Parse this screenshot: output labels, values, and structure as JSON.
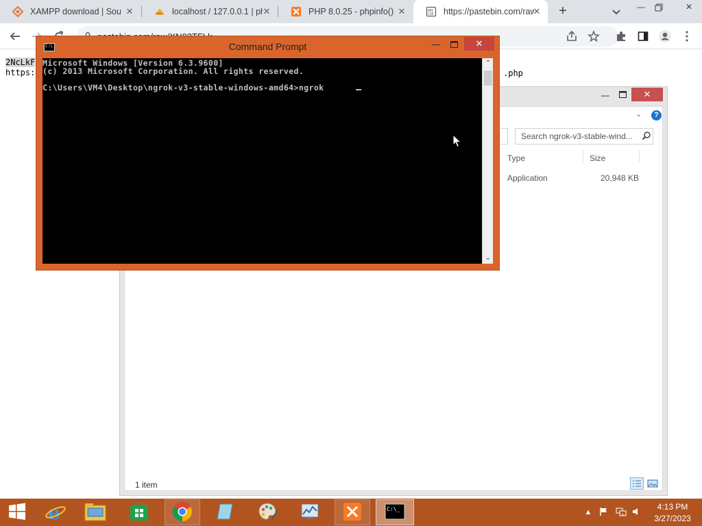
{
  "browser": {
    "tabs": [
      {
        "title": "XAMPP download | Sour",
        "icon": "xampp-orange-icon"
      },
      {
        "title": "localhost / 127.0.0.1 | php",
        "icon": "phpmyadmin-icon"
      },
      {
        "title": "PHP 8.0.25 - phpinfo()",
        "icon": "xampp-icon"
      },
      {
        "title": "https://pastebin.com/raw",
        "icon": "pastebin-icon",
        "active": true
      }
    ],
    "address": "pastebin.com/raw/XN03TFLk"
  },
  "page": {
    "highlight_text": "2NcLkF",
    "line2": "https:",
    "line2_suffix": ".php"
  },
  "cmd": {
    "title": "Command Prompt",
    "lines": [
      "Microsoft Windows [Version 6.3.9600]",
      "(c) 2013 Microsoft Corporation. All rights reserved.",
      "",
      "C:\\Users\\VM4\\Desktop\\ngrok-v3-stable-windows-amd64>ngrok"
    ]
  },
  "explorer": {
    "search_placeholder": "Search ngrok-v3-stable-wind...",
    "columns": [
      "Type",
      "Size"
    ],
    "rows": [
      {
        "type": "Application",
        "size": "20,948 KB"
      }
    ],
    "status": "1 item"
  },
  "taskbar": {
    "time": "4:13 PM",
    "date": "3/27/2023"
  },
  "colors": {
    "taskbar": "#b25420",
    "cmd_frame": "#d9652d",
    "close_red": "#c6453c"
  }
}
